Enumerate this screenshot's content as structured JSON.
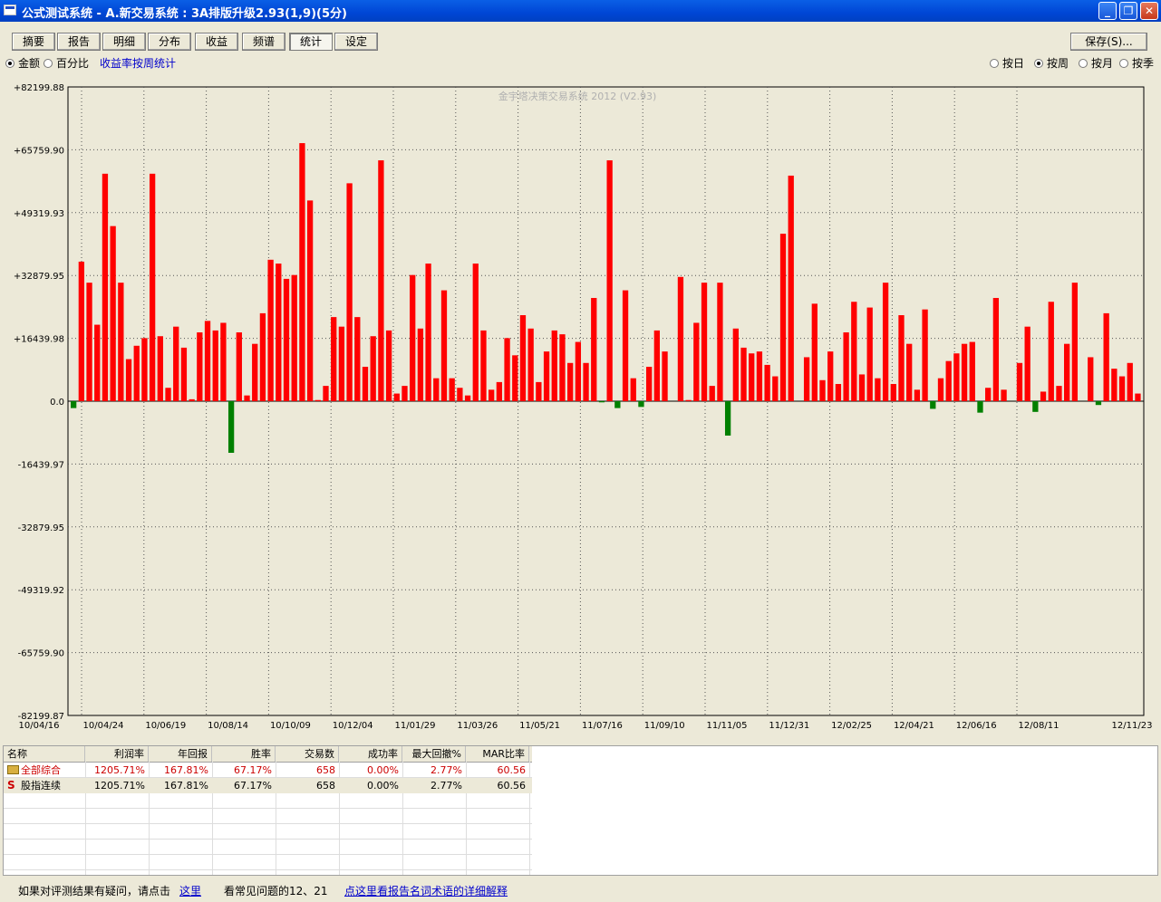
{
  "window": {
    "title": "公式测试系统 - A.新交易系统 : 3A排版升级2.93(1,9)(5分)"
  },
  "tabs": [
    "摘要",
    "报告",
    "明细",
    "分布",
    "收益",
    "频谱",
    "统计",
    "设定"
  ],
  "active_tab": "统计",
  "save_label": "保存(S)...",
  "mode_options": {
    "amount": "金额",
    "percent": "百分比",
    "selected": "金额"
  },
  "link_text": "收益率按周统计",
  "period_options": {
    "day": "按日",
    "week": "按周",
    "month": "按月",
    "season": "按季",
    "selected": "按周"
  },
  "chart_data": {
    "type": "bar",
    "watermark": "金宇塔决策交易系统 2012 (V2.93)",
    "ylim": [
      -82199.87,
      82199.88
    ],
    "y_ticks": [
      "+82199.88",
      "+65759.90",
      "+49319.93",
      "+32879.95",
      "+16439.98",
      "0.0",
      "-16439.97",
      "-32879.95",
      "-49319.92",
      "-65759.90",
      "-82199.87"
    ],
    "x_ticks": [
      "10/04/16",
      "10/04/24",
      "10/06/19",
      "10/08/14",
      "10/10/09",
      "10/12/04",
      "11/01/29",
      "11/03/26",
      "11/05/21",
      "11/07/16",
      "11/09/10",
      "11/11/05",
      "11/12/31",
      "12/02/25",
      "12/04/21",
      "12/06/16",
      "12/08/11",
      "12/11/23"
    ],
    "grid": true,
    "positive_color": "#FF0000",
    "negative_color": "#008000",
    "values": [
      -1800,
      36500,
      31000,
      20000,
      59500,
      45800,
      31000,
      11000,
      14500,
      16500,
      59500,
      17000,
      3500,
      19500,
      14000,
      500,
      18000,
      21000,
      18500,
      20500,
      -13500,
      18000,
      1500,
      15000,
      23000,
      37000,
      36000,
      32000,
      33000,
      67500,
      52500,
      300,
      4000,
      22000,
      19500,
      57000,
      22000,
      9000,
      17000,
      63000,
      18500,
      2000,
      4000,
      33000,
      19000,
      36000,
      6000,
      29000,
      6000,
      3500,
      1500,
      36000,
      18500,
      3000,
      5000,
      16500,
      12000,
      22500,
      19000,
      5000,
      13000,
      18500,
      17500,
      10000,
      15500,
      10000,
      27000,
      -300,
      63000,
      -1800,
      29000,
      6000,
      -1500,
      9000,
      18500,
      13000,
      0,
      32500,
      300,
      20500,
      31000,
      4000,
      31000,
      -9000,
      19000,
      14000,
      12500,
      13000,
      9500,
      6500,
      43800,
      59000,
      0,
      11500,
      25500,
      5500,
      13000,
      4500,
      18000,
      26000,
      7000,
      24500,
      6000,
      31000,
      4500,
      22500,
      15000,
      3000,
      24000,
      -2000,
      6000,
      10500,
      12500,
      15000,
      15500,
      -3000,
      3500,
      27000,
      3000,
      0,
      10000,
      19500,
      -2800,
      2500,
      26000,
      4000,
      15000,
      31000,
      0,
      11500,
      -1000,
      23000,
      8500,
      6500,
      10000,
      2000
    ]
  },
  "table": {
    "headers": [
      "名称",
      "利润率",
      "年回报",
      "胜率",
      "交易数",
      "成功率",
      "最大回撤%",
      "MAR比率"
    ],
    "rows": [
      {
        "icon": "folder-icon",
        "name": "全部综合",
        "profit": "1205.71%",
        "annual": "167.81%",
        "winrate": "67.17%",
        "trades": "658",
        "success": "0.00%",
        "drawdown": "2.77%",
        "mar": "60.56"
      },
      {
        "icon": "s-icon",
        "icon_text": "S",
        "name": "股指连续",
        "profit": "1205.71%",
        "annual": "167.81%",
        "winrate": "67.17%",
        "trades": "658",
        "success": "0.00%",
        "drawdown": "2.77%",
        "mar": "60.56"
      }
    ]
  },
  "footer": {
    "text1": "如果对评测结果有疑问，请点击",
    "link1": "这里",
    "text2": "看常见问题的12、21",
    "link2": "点这里看报告名词术语的详细解释"
  },
  "colors": {
    "accent": "#0046D5",
    "folder": "#D8B040",
    "s_icon": "#CC0000"
  }
}
